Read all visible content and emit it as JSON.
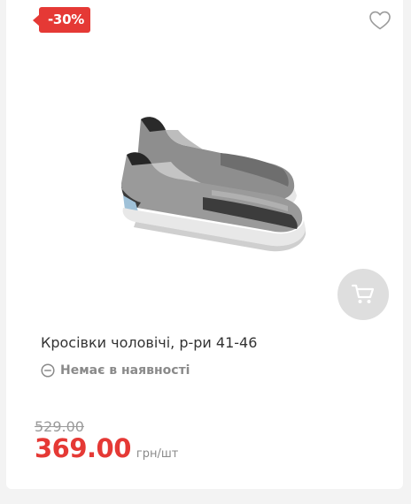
{
  "product": {
    "discount": "-30%",
    "title": "Кросівки чоловічі, р-ри 41-46",
    "stock_status": "Немає в наявності",
    "old_price": "529.00",
    "price": "369.00",
    "unit": "грн/шт"
  },
  "icons": {
    "wishlist": "heart-outline-icon",
    "cart": "shopping-cart-icon",
    "stock": "minus-circle-icon"
  },
  "colors": {
    "accent": "#e53935",
    "muted": "#8a8a8a",
    "cart_bg": "#dedede"
  }
}
